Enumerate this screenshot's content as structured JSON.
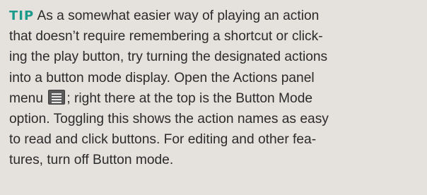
{
  "tip": {
    "label": "TIP",
    "lines": [
      " As a somewhat easier way of playing an action",
      "that doesn’t require remembering a shortcut or click-",
      "ing the play button, try turning the designated actions",
      "into a button mode display. Open the Actions panel",
      "; right there at the top is the Button Mode",
      "option. Toggling this shows the action names as easy",
      "to read and click buttons. For editing and other fea-",
      "tures, turn off Button mode."
    ],
    "line4_prefix": "menu ",
    "panel_menu_icon": "panel-menu-icon",
    "colors": {
      "label": "#1a9a8a",
      "background": "#e5e1dd",
      "text": "#2b2b2b"
    }
  }
}
